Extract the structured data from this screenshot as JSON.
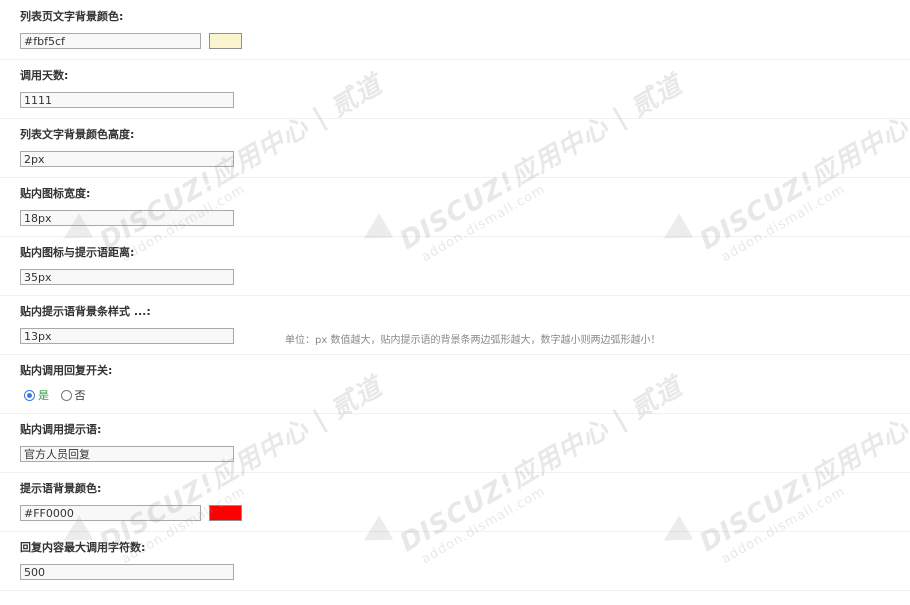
{
  "fields": [
    {
      "label": "列表页文字背景颜色:",
      "value": "#fbf5cf",
      "swatch": "#fbf5cf"
    },
    {
      "label": "调用天数:",
      "value": "1111"
    },
    {
      "label": "列表文字背景颜色高度:",
      "value": "2px"
    },
    {
      "label": "贴内图标宽度:",
      "value": "18px"
    },
    {
      "label": "贴内图标与提示语距离:",
      "value": "35px"
    },
    {
      "label": "贴内提示语背景条样式 ...:",
      "value": "13px",
      "hint": "单位：px 数值越大，贴内提示语的背景条两边弧形越大，数字越小则两边弧形越小！"
    },
    {
      "label": "贴内调用回复开关:",
      "options": [
        "是",
        "否"
      ],
      "selected": "是"
    },
    {
      "label": "贴内调用提示语:",
      "value": "官方人员回复"
    },
    {
      "label": "提示语背景颜色:",
      "value": "#FF0000",
      "swatch": "#FF0000"
    },
    {
      "label": "回复内容最大调用字符数:",
      "value": "500"
    }
  ],
  "watermark": {
    "brand": "DISCUZ!应用中心 | 贰道",
    "domain": "addon.dismall.com"
  },
  "colors": {
    "accent_radio": "#3a78e6",
    "selected_option_text": "#2e9e3e"
  }
}
